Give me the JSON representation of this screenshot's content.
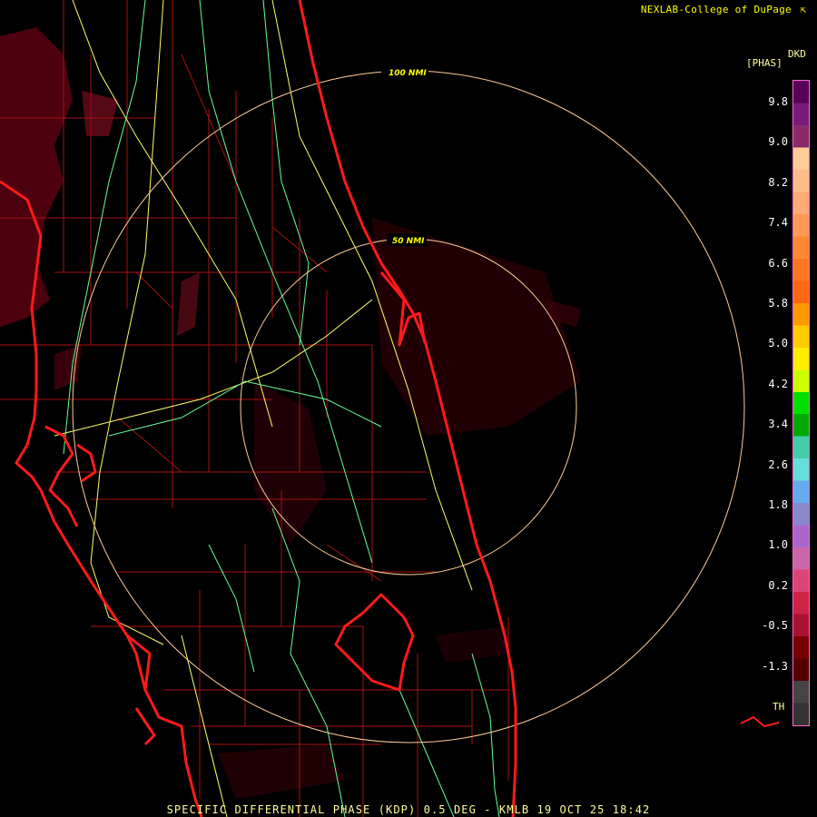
{
  "credit": "NEXLAB-College of DuPage",
  "credit_icon": "cursor-icon",
  "product": {
    "unit": "[PHAS]",
    "code": "DKD"
  },
  "ring_labels": [
    "100 NMI",
    "50 NMI"
  ],
  "legend": {
    "ticks": [
      "9.8",
      "9.0",
      "8.2",
      "7.4",
      "6.6",
      "5.8",
      "5.0",
      "4.2",
      "3.4",
      "2.6",
      "1.8",
      "1.0",
      "0.2",
      "-0.5",
      "-1.3"
    ],
    "th_label": "TH",
    "colors": [
      "#5a005a",
      "#7a1a7a",
      "#8a2a6a",
      "#ffcc99",
      "#ffbb88",
      "#ffaa77",
      "#ff9955",
      "#ff8833",
      "#ff7722",
      "#ff6611",
      "#ff9900",
      "#ffcc00",
      "#ffee00",
      "#ccff00",
      "#00dd00",
      "#00aa00",
      "#44ccaa",
      "#66dddd",
      "#66aaee",
      "#8888cc",
      "#aa66cc",
      "#cc66aa",
      "#dd4477",
      "#cc2244",
      "#aa1133",
      "#770000",
      "#550000",
      "#444444",
      "#333333"
    ]
  },
  "footer": "SPECIFIC DIFFERENTIAL PHASE (KDP) 0.5 DEG - KMLB 19 OCT 25 18:42",
  "colors": {
    "coast": "#ff1a1a",
    "county": "#aa1010",
    "highway": "#ffff66",
    "road": "#66ff99",
    "ring": "#ffcc99",
    "label": "#ffff99"
  }
}
